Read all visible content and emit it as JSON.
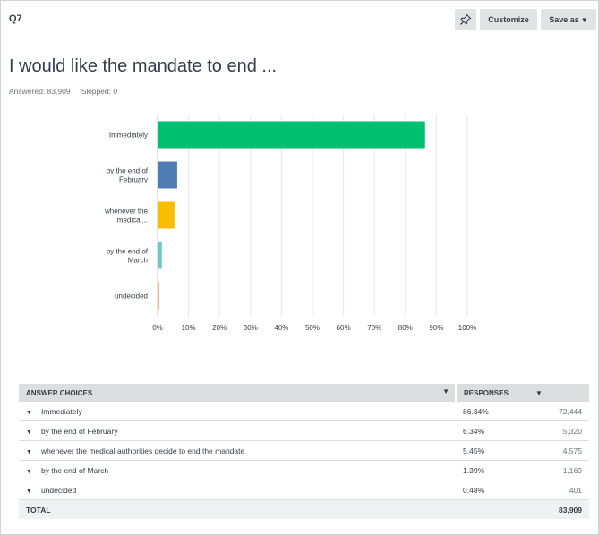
{
  "header": {
    "question_number": "Q7",
    "customize_label": "Customize",
    "save_as_label": "Save as",
    "title": "I would like the mandate to end ...",
    "answered": "Answered: 83,909",
    "skipped": "Skipped: 0"
  },
  "chart_data": {
    "type": "bar",
    "orientation": "horizontal",
    "categories": [
      [
        "Immediately"
      ],
      [
        "by the end of",
        "February"
      ],
      [
        "whenever the",
        "medical..."
      ],
      [
        "by the end of",
        "March"
      ],
      [
        "undecided"
      ]
    ],
    "values": [
      86.34,
      6.34,
      5.45,
      1.39,
      0.48
    ],
    "colors": [
      "#00bf6f",
      "#507cb6",
      "#f9be00",
      "#6bc8cd",
      "#ff8b4f"
    ],
    "xlim": [
      0,
      100
    ],
    "x_ticks": [
      "0%",
      "10%",
      "20%",
      "30%",
      "40%",
      "50%",
      "60%",
      "70%",
      "80%",
      "90%",
      "100%"
    ],
    "grid": true
  },
  "table": {
    "col_choices": "ANSWER CHOICES",
    "col_responses": "RESPONSES",
    "rows": [
      {
        "choice": "Immediately",
        "pct": "86.34%",
        "count": "72,444"
      },
      {
        "choice": "by the end of February",
        "pct": "6.34%",
        "count": "5,320"
      },
      {
        "choice": "whenever the medical authorities decide to end the mandate",
        "pct": "5.45%",
        "count": "4,575"
      },
      {
        "choice": "by the end of March",
        "pct": "1.39%",
        "count": "1,169"
      },
      {
        "choice": "undecided",
        "pct": "0.48%",
        "count": "401"
      }
    ],
    "total_label": "TOTAL",
    "total_count": "83,909"
  }
}
